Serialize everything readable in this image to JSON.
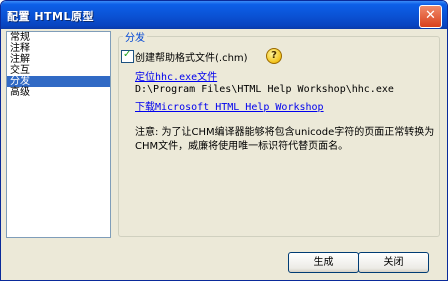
{
  "window": {
    "title": "配置 HTML原型",
    "close_label": "✕"
  },
  "sidebar": {
    "items": [
      {
        "label": "常规",
        "selected": false
      },
      {
        "label": "注释",
        "selected": false
      },
      {
        "label": "注解",
        "selected": false
      },
      {
        "label": "交互",
        "selected": false
      },
      {
        "label": "分发",
        "selected": true
      },
      {
        "label": "高级",
        "selected": false
      }
    ]
  },
  "group": {
    "label": "分发",
    "checkbox": {
      "label": "创建帮助格式文件(.chm)",
      "checked": true
    },
    "help_icon": "?",
    "hhc_link": "定位hhc.exe文件",
    "hhc_path": "D:\\Program Files\\HTML Help Workshop\\hhc.exe",
    "download_link": "下载Microsoft HTML Help Workshop",
    "note": "注意: 为了让CHM编译器能够将包含unicode字符的页面正常转换为CHM文件，威廉将使用唯一标识符代替页面名。"
  },
  "buttons": {
    "generate": "生成",
    "close": "关闭"
  },
  "colors": {
    "title_bar": "#0a53d6",
    "selection": "#316ac5",
    "link": "#0000ee",
    "group_label": "#0046d5"
  }
}
